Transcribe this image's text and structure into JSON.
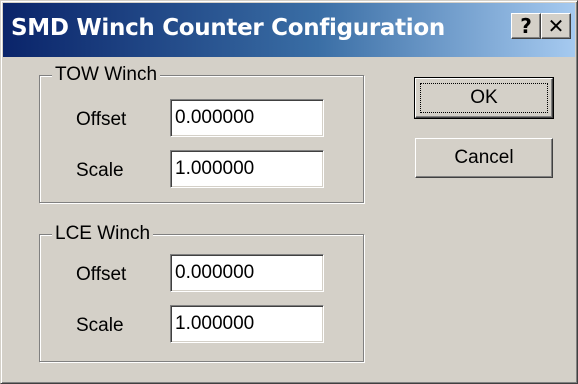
{
  "window": {
    "title": "SMD Winch Counter Configuration",
    "help_button": "?",
    "close_button": "✕"
  },
  "tow_winch": {
    "legend": "TOW Winch",
    "offset_label": "Offset",
    "offset_value": "0.000000",
    "scale_label": "Scale",
    "scale_value": "1.000000"
  },
  "lce_winch": {
    "legend": "LCE Winch",
    "offset_label": "Offset",
    "offset_value": "0.000000",
    "scale_label": "Scale",
    "scale_value": "1.000000"
  },
  "buttons": {
    "ok_label": "OK",
    "cancel_label": "Cancel"
  }
}
